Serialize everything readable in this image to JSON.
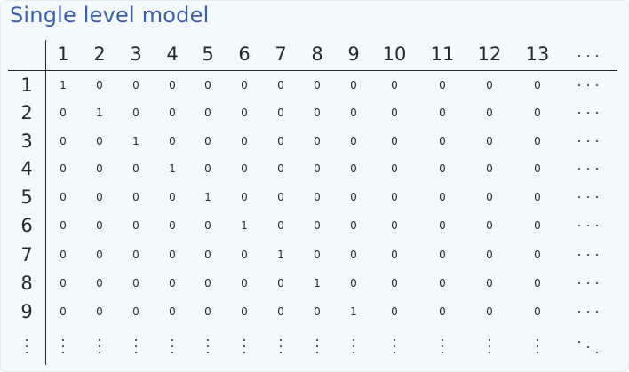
{
  "title": "Single level model",
  "matrix": {
    "column_headers": [
      "1",
      "2",
      "3",
      "4",
      "5",
      "6",
      "7",
      "8",
      "9",
      "10",
      "11",
      "12",
      "13"
    ],
    "row_headers": [
      "1",
      "2",
      "3",
      "4",
      "5",
      "6",
      "7",
      "8",
      "9"
    ],
    "rows": [
      [
        "1",
        "0",
        "0",
        "0",
        "0",
        "0",
        "0",
        "0",
        "0",
        "0",
        "0",
        "0",
        "0"
      ],
      [
        "0",
        "1",
        "0",
        "0",
        "0",
        "0",
        "0",
        "0",
        "0",
        "0",
        "0",
        "0",
        "0"
      ],
      [
        "0",
        "0",
        "1",
        "0",
        "0",
        "0",
        "0",
        "0",
        "0",
        "0",
        "0",
        "0",
        "0"
      ],
      [
        "0",
        "0",
        "0",
        "1",
        "0",
        "0",
        "0",
        "0",
        "0",
        "0",
        "0",
        "0",
        "0"
      ],
      [
        "0",
        "0",
        "0",
        "0",
        "1",
        "0",
        "0",
        "0",
        "0",
        "0",
        "0",
        "0",
        "0"
      ],
      [
        "0",
        "0",
        "0",
        "0",
        "0",
        "1",
        "0",
        "0",
        "0",
        "0",
        "0",
        "0",
        "0"
      ],
      [
        "0",
        "0",
        "0",
        "0",
        "0",
        "0",
        "1",
        "0",
        "0",
        "0",
        "0",
        "0",
        "0"
      ],
      [
        "0",
        "0",
        "0",
        "0",
        "0",
        "0",
        "0",
        "1",
        "0",
        "0",
        "0",
        "0",
        "0"
      ],
      [
        "0",
        "0",
        "0",
        "0",
        "0",
        "0",
        "0",
        "0",
        "1",
        "0",
        "0",
        "0",
        "0"
      ]
    ],
    "ellipsis": {
      "horizontal": "⋯",
      "vertical": "⋮",
      "diagonal": "⋱"
    }
  }
}
